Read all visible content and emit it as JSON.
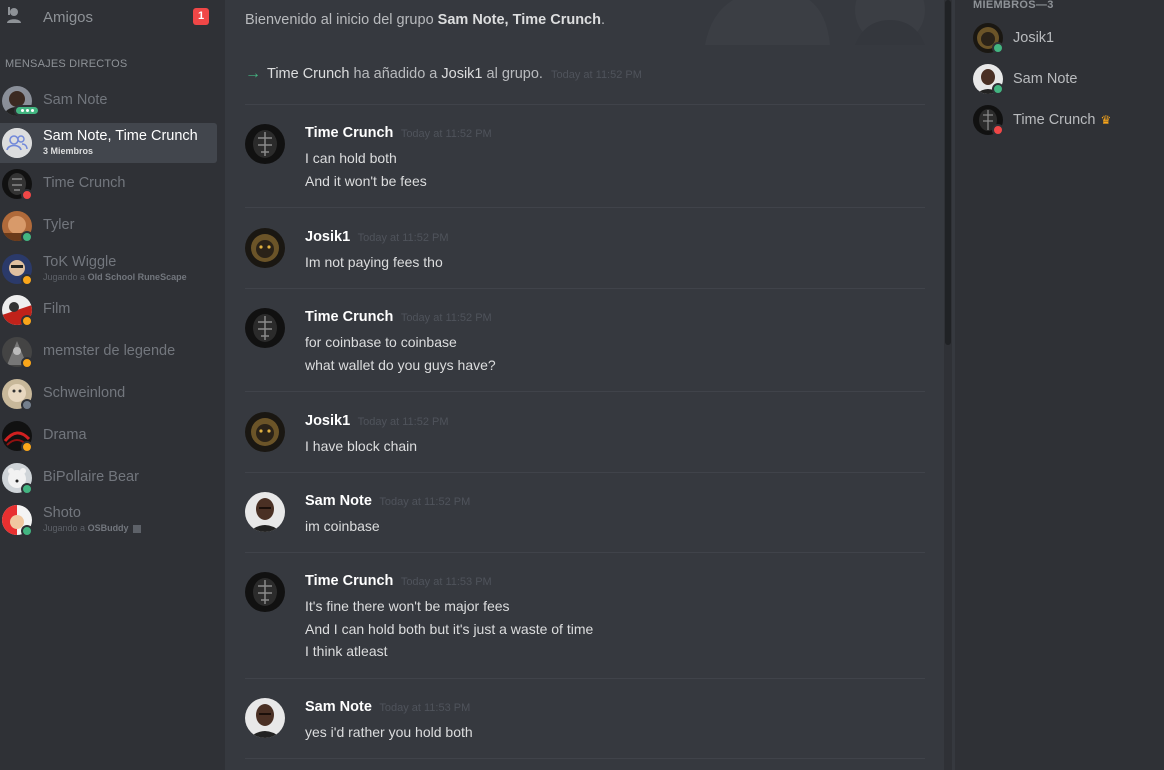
{
  "sidebar": {
    "friends_label": "Amigos",
    "friends_badge": "1",
    "dm_header": "MENSAJES DIRECTOS",
    "dms": [
      {
        "name": "Sam Note",
        "sub": "",
        "status": "typing",
        "avatar": "sam"
      },
      {
        "name": "Sam Note, Time Crunch",
        "sub": "3 Miembros",
        "status": "",
        "avatar": "group",
        "active": true
      },
      {
        "name": "Time Crunch",
        "sub": "",
        "status": "dnd",
        "avatar": "time"
      },
      {
        "name": "Tyler",
        "sub": "",
        "status": "online",
        "avatar": "tyler"
      },
      {
        "name": "ToK Wiggle",
        "sub_prefix": "Jugando a",
        "sub_game": "Old School RuneScape",
        "status": "idle",
        "avatar": "tok"
      },
      {
        "name": "Film",
        "sub": "",
        "status": "idle",
        "avatar": "film"
      },
      {
        "name": "memster de legende",
        "sub": "",
        "status": "idle",
        "avatar": "memster"
      },
      {
        "name": "Schweinlond",
        "sub": "",
        "status": "offline",
        "avatar": "schwein"
      },
      {
        "name": "Drama",
        "sub": "",
        "status": "idle",
        "avatar": "drama"
      },
      {
        "name": "BiPollaire Bear",
        "sub": "",
        "status": "online",
        "avatar": "bear"
      },
      {
        "name": "Shoto",
        "sub_prefix": "Jugando a",
        "sub_game": "OSBuddy",
        "status": "online",
        "avatar": "shoto"
      }
    ]
  },
  "chat": {
    "welcome_prefix": "Bienvenido al inicio del grupo",
    "welcome_group": "Sam Note, Time Crunch",
    "welcome_suffix": ".",
    "join": {
      "actor": "Time Crunch",
      "verb": "ha añadido a",
      "target": "Josik1",
      "suffix": "al grupo.",
      "time": "Today at 11:52 PM"
    },
    "messages": [
      {
        "author": "Time Crunch",
        "time": "Today at 11:52 PM",
        "avatar": "time",
        "lines": [
          "I can hold both",
          "And it won't be fees"
        ]
      },
      {
        "author": "Josik1",
        "time": "Today at 11:52 PM",
        "avatar": "josik",
        "lines": [
          "Im not paying fees tho"
        ]
      },
      {
        "author": "Time Crunch",
        "time": "Today at 11:52 PM",
        "avatar": "time",
        "lines": [
          "for coinbase to coinbase",
          "what wallet do you guys have?"
        ]
      },
      {
        "author": "Josik1",
        "time": "Today at 11:52 PM",
        "avatar": "josik",
        "lines": [
          "I have block chain"
        ]
      },
      {
        "author": "Sam Note",
        "time": "Today at 11:52 PM",
        "avatar": "sam",
        "lines": [
          "im coinbase"
        ]
      },
      {
        "author": "Time Crunch",
        "time": "Today at 11:53 PM",
        "avatar": "time",
        "lines": [
          "It's fine there won't be major fees",
          "And I can hold both but it's just a waste of time",
          "I think atleast"
        ]
      },
      {
        "author": "Sam Note",
        "time": "Today at 11:53 PM",
        "avatar": "sam",
        "lines": [
          "yes i'd rather you hold both"
        ]
      }
    ]
  },
  "members": {
    "header": "MIEMBROS—3",
    "list": [
      {
        "name": "Josik1",
        "status": "online",
        "avatar": "josik",
        "owner": false
      },
      {
        "name": "Sam Note",
        "status": "online",
        "avatar": "sam",
        "owner": false
      },
      {
        "name": "Time Crunch",
        "status": "dnd",
        "avatar": "time",
        "owner": true
      }
    ]
  },
  "icons": {
    "friends": "friends-icon",
    "group": "group-icon",
    "crown": "crown-icon",
    "arrow": "join-arrow-icon"
  }
}
